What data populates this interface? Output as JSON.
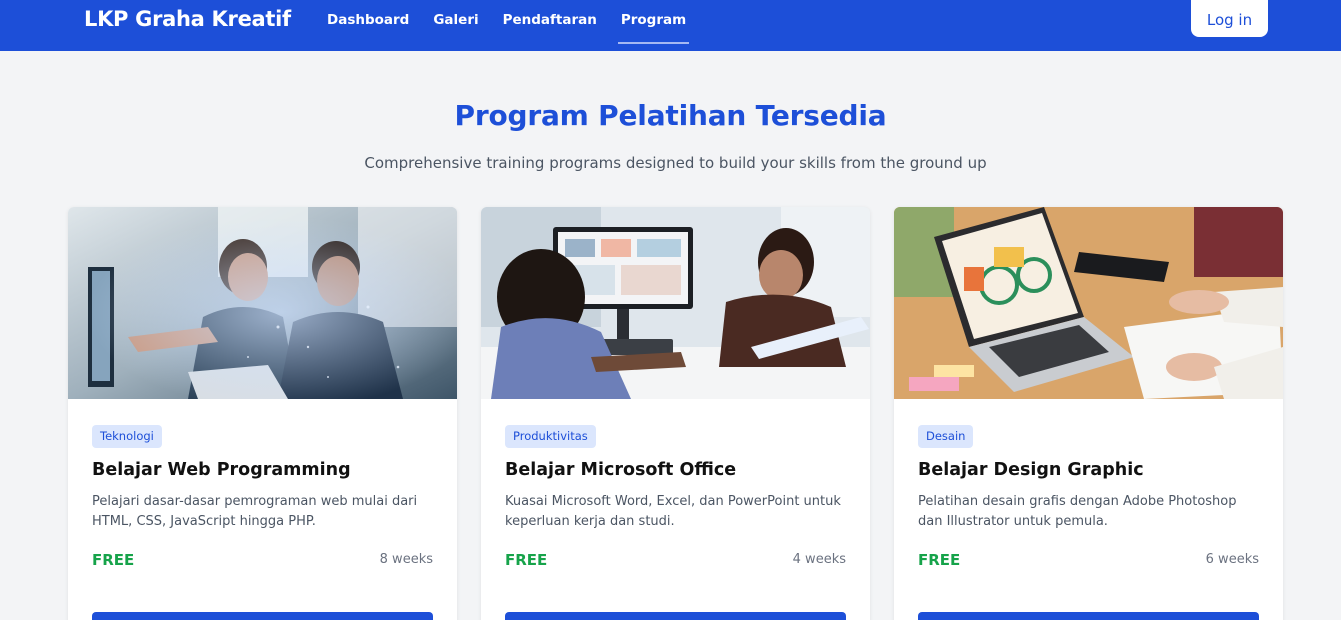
{
  "nav": {
    "brand": "LKP Graha Kreatif",
    "links": [
      "Dashboard",
      "Galeri",
      "Pendaftaran",
      "Program"
    ],
    "active": "Program",
    "login_label": "Log in"
  },
  "main": {
    "title": "Program Pelatihan Tersedia",
    "subtitle": "Comprehensive training programs designed to build your skills from the ground up"
  },
  "programs": [
    {
      "category": "Teknologi",
      "title": "Belajar Web Programming",
      "description": "Pelajari dasar-dasar pemrograman web mulai dari HTML, CSS, JavaScript hingga PHP.",
      "price": "FREE",
      "duration": "8 weeks"
    },
    {
      "category": "Produktivitas",
      "title": "Belajar Microsoft Office",
      "description": "Kuasai Microsoft Word, Excel, dan PowerPoint untuk keperluan kerja dan studi.",
      "price": "FREE",
      "duration": "4 weeks"
    },
    {
      "category": "Desain",
      "title": "Belajar Design Graphic",
      "description": "Pelatihan desain grafis dengan Adobe Photoshop dan Illustrator untuk pemula.",
      "price": "FREE",
      "duration": "6 weeks"
    }
  ],
  "colors": {
    "primary": "#1d4fd8",
    "background": "#f3f4f6",
    "price_green": "#16a34a",
    "badge_bg": "#dbe6fd"
  }
}
